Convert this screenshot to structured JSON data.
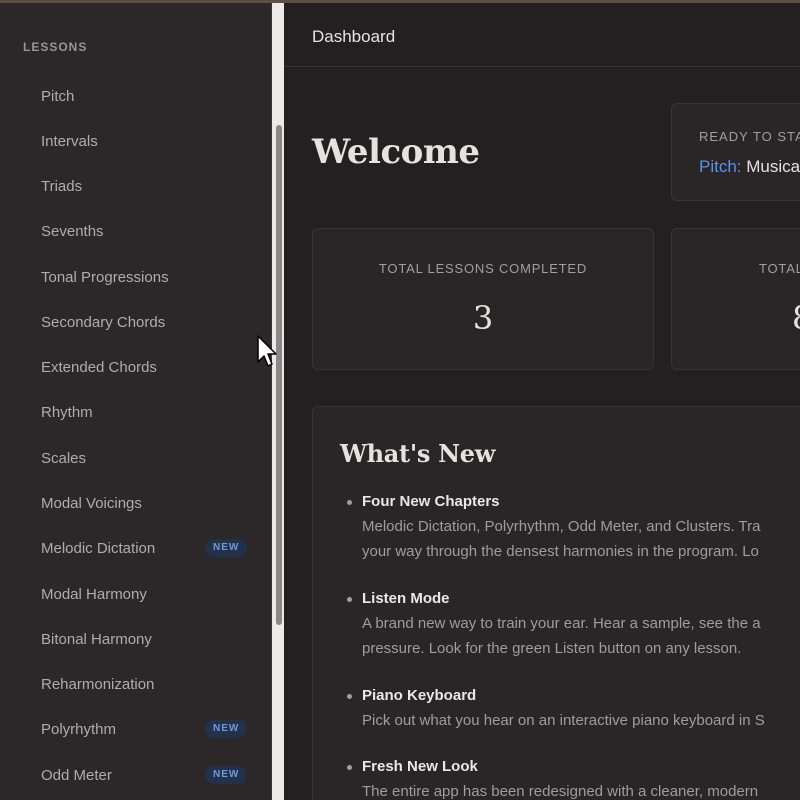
{
  "sidebar": {
    "heading": "LESSONS",
    "items": [
      {
        "label": "Pitch",
        "badge": ""
      },
      {
        "label": "Intervals",
        "badge": ""
      },
      {
        "label": "Triads",
        "badge": ""
      },
      {
        "label": "Sevenths",
        "badge": ""
      },
      {
        "label": "Tonal Progressions",
        "badge": ""
      },
      {
        "label": "Secondary Chords",
        "badge": ""
      },
      {
        "label": "Extended Chords",
        "badge": ""
      },
      {
        "label": "Rhythm",
        "badge": ""
      },
      {
        "label": "Scales",
        "badge": ""
      },
      {
        "label": "Modal Voicings",
        "badge": ""
      },
      {
        "label": "Melodic Dictation",
        "badge": "NEW"
      },
      {
        "label": "Modal Harmony",
        "badge": ""
      },
      {
        "label": "Bitonal Harmony",
        "badge": ""
      },
      {
        "label": "Reharmonization",
        "badge": ""
      },
      {
        "label": "Polyrhythm",
        "badge": "NEW"
      },
      {
        "label": "Odd Meter",
        "badge": "NEW"
      }
    ]
  },
  "header": {
    "title": "Dashboard"
  },
  "main": {
    "welcome": "Welcome",
    "ready": {
      "label": "READY TO STA",
      "category": "Pitch:",
      "lesson": " Musica"
    },
    "stats": [
      {
        "label": "TOTAL LESSONS COMPLETED",
        "value": "3"
      },
      {
        "label": "TOTAL",
        "value": "8"
      }
    ],
    "whats_new": {
      "title": "What's New",
      "items": [
        {
          "head": "Four New Chapters",
          "lines": [
            "Melodic Dictation, Polyrhythm, Odd Meter, and Clusters. Tra",
            "your way through the densest harmonies in the program. Lo"
          ]
        },
        {
          "head": "Listen Mode",
          "lines": [
            "A brand new way to train your ear. Hear a sample, see the a",
            "pressure. Look for the green Listen button on any lesson."
          ]
        },
        {
          "head": "Piano Keyboard",
          "lines": [
            "Pick out what you hear on an interactive piano keyboard in S"
          ]
        },
        {
          "head": "Fresh New Look",
          "lines": [
            "The entire app has been redesigned with a cleaner, modern"
          ]
        }
      ]
    }
  },
  "colors": {
    "accent": "#5b93e6",
    "badge_bg": "#23324a",
    "background": "#242021",
    "sidebar_bg": "#2c2729"
  },
  "icons": {
    "cursor": "arrow-cursor-icon",
    "bullet": "bullet-dot-icon"
  }
}
